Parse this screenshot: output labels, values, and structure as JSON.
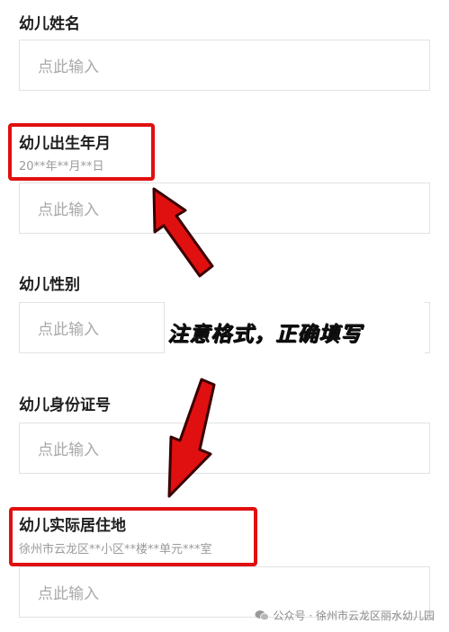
{
  "fields": [
    {
      "label": "幼儿姓名",
      "placeholder": "点此输入"
    },
    {
      "label": "幼儿出生年月",
      "hint": "20**年**月**日",
      "placeholder": "点此输入"
    },
    {
      "label": "幼儿性别",
      "placeholder": "点此输入"
    },
    {
      "label": "幼儿身份证号",
      "placeholder": "点此输入"
    },
    {
      "label": "幼儿实际居住地",
      "hint": "徐州市云龙区**小区**楼**单元***室",
      "placeholder": "点此输入"
    }
  ],
  "annotation": "注意格式，正确填写",
  "footer": {
    "icon": "wechat-icon",
    "text": "公众号 · 徐州市云龙区丽水幼儿园"
  },
  "colors": {
    "highlight": "#e01010",
    "arrow": "#e01010",
    "placeholder": "#a9a9a9",
    "border": "#e2e2e2"
  }
}
